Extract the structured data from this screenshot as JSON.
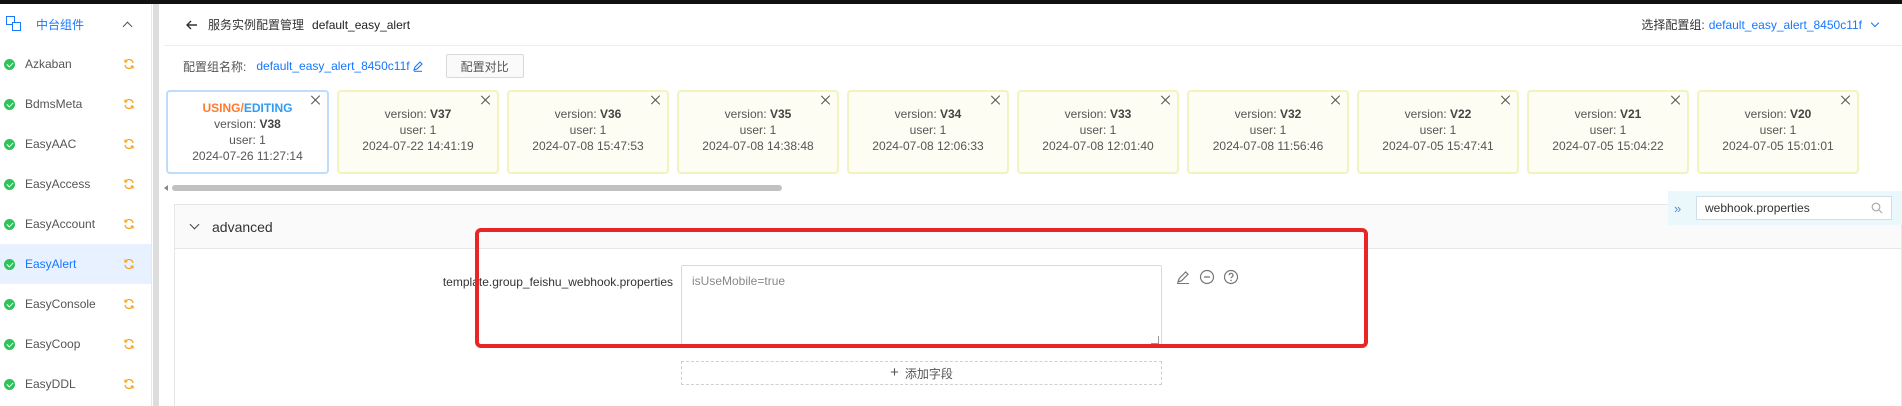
{
  "sidebar": {
    "group_label": "中台组件",
    "items": [
      {
        "label": "Azkaban",
        "active": false
      },
      {
        "label": "BdmsMeta",
        "active": false
      },
      {
        "label": "EasyAAC",
        "active": false
      },
      {
        "label": "EasyAccess",
        "active": false
      },
      {
        "label": "EasyAccount",
        "active": false
      },
      {
        "label": "EasyAlert",
        "active": true
      },
      {
        "label": "EasyConsole",
        "active": false
      },
      {
        "label": "EasyCoop",
        "active": false
      },
      {
        "label": "EasyDDL",
        "active": false
      }
    ]
  },
  "header": {
    "breadcrumb_parent": "服务实例配置管理",
    "breadcrumb_current": "default_easy_alert",
    "select_label": "选择配置组:",
    "select_value": "default_easy_alert_8450c11f"
  },
  "subbar": {
    "group_label": "配置组名称:",
    "group_value": "default_easy_alert_8450c11f",
    "compare_button": "配置对比"
  },
  "versions": [
    {
      "status_using": "USING",
      "status_sep": "/",
      "status_editing": "EDITING",
      "version_prefix": "version: ",
      "version": "V38",
      "user": "user: 1",
      "time": "2024-07-26 11:27:14",
      "current": true
    },
    {
      "version_prefix": "version: ",
      "version": "V37",
      "user": "user: 1",
      "time": "2024-07-22 14:41:19"
    },
    {
      "version_prefix": "version: ",
      "version": "V36",
      "user": "user: 1",
      "time": "2024-07-08 15:47:53"
    },
    {
      "version_prefix": "version: ",
      "version": "V35",
      "user": "user: 1",
      "time": "2024-07-08 14:38:48"
    },
    {
      "version_prefix": "version: ",
      "version": "V34",
      "user": "user: 1",
      "time": "2024-07-08 12:06:33"
    },
    {
      "version_prefix": "version: ",
      "version": "V33",
      "user": "user: 1",
      "time": "2024-07-08 12:01:40"
    },
    {
      "version_prefix": "version: ",
      "version": "V32",
      "user": "user: 1",
      "time": "2024-07-08 11:56:46"
    },
    {
      "version_prefix": "version: ",
      "version": "V22",
      "user": "user: 1",
      "time": "2024-07-05 15:47:41"
    },
    {
      "version_prefix": "version: ",
      "version": "V21",
      "user": "user: 1",
      "time": "2024-07-05 15:04:22"
    },
    {
      "version_prefix": "version: ",
      "version": "V20",
      "user": "user: 1",
      "time": "2024-07-05 15:01:01"
    }
  ],
  "panel": {
    "title": "advanced",
    "field_label": "template.group_feishu_webhook.properties",
    "field_value": "isUseMobile=true",
    "add_field": "添加字段"
  },
  "search": {
    "value": "webhook.properties"
  },
  "colors": {
    "accent": "#1677ff",
    "using": "#ff7a2f",
    "editing": "#2f9cf6",
    "check": "#2fc25b",
    "sync": "#f5a623",
    "highlight": "#ea2525"
  },
  "icons": {
    "group": "component-group-icon",
    "status": "check-circle-icon",
    "sync": "sync-icon",
    "back": "arrow-left-icon",
    "edit": "pencil-icon",
    "close": "close-icon",
    "remove": "minus-circle-icon",
    "help": "question-circle-icon",
    "search": "search-icon",
    "expand": "double-chevron-right-icon"
  }
}
